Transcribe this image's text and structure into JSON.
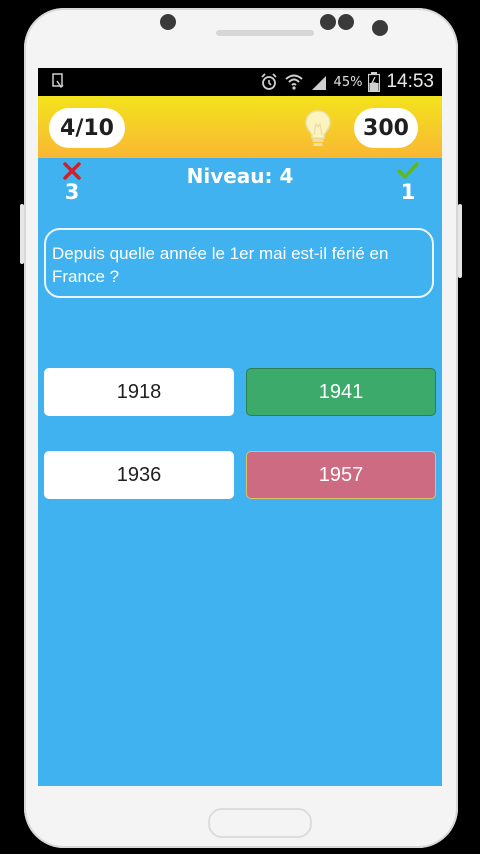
{
  "status_bar": {
    "battery_percent": "45%",
    "time": "14:53"
  },
  "header": {
    "progress": "4/10",
    "score": "300",
    "icons": {
      "hint": "lightbulb-icon"
    }
  },
  "stats": {
    "wrong": {
      "icon": "cross-icon",
      "count": "3"
    },
    "correct": {
      "icon": "check-icon",
      "count": "1"
    }
  },
  "level_label": "Niveau: 4",
  "question": "Depuis quelle année le 1er mai est-il férié en France ?",
  "answers": [
    {
      "label": "1918",
      "state": "default"
    },
    {
      "label": "1941",
      "state": "correct"
    },
    {
      "label": "1936",
      "state": "default"
    },
    {
      "label": "1957",
      "state": "wrong"
    }
  ],
  "colors": {
    "screen_bg": "#3fb2ef",
    "header_top": "#f3e31c",
    "header_bottom": "#f9b734",
    "answer_default": "#ffffff",
    "answer_correct": "#3caa6b",
    "answer_wrong": "#cd6b82",
    "wrong_icon": "#d0212a",
    "check_icon": "#5fb81e"
  }
}
